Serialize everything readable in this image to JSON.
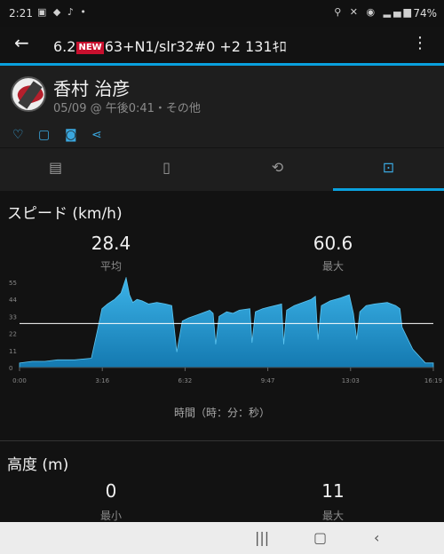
{
  "status_bar": {
    "time": "2:21",
    "battery": "74%"
  },
  "app_bar": {
    "title_pre": "6.2",
    "badge": "NEW",
    "title_post": "63+N1/slr32#0 +2 131ｷﾛ"
  },
  "activity": {
    "user_name": "香村 治彦",
    "meta": "05/09 @ 午後0:41・その他"
  },
  "speed": {
    "title": "スピード (km/h)",
    "avg_value": "28.4",
    "avg_label": "平均",
    "max_value": "60.6",
    "max_label": "最大",
    "x_axis_title": "時間（時：分：秒）"
  },
  "altitude": {
    "title": "高度 (m)",
    "min_value": "0",
    "min_label": "最小",
    "max_value": "11",
    "max_label": "最大"
  },
  "icons": {
    "back": "arrow-left-icon",
    "more": "more-vert-icon",
    "like": "heart-icon",
    "comment": "comment-icon",
    "photo": "camera-icon",
    "share": "share-icon",
    "tab_overview": "map-image-icon",
    "tab_details": "document-icon",
    "tab_laps": "laps-icon",
    "tab_charts": "chart-icon"
  },
  "colors": {
    "accent": "#0aa1de",
    "fill_top": "#3cb3e8",
    "fill_bottom": "#1479b0",
    "background": "#121212"
  },
  "chart_data": {
    "type": "area",
    "title": "スピード (km/h)",
    "xlabel": "時間（時：分：秒）",
    "ylabel": "",
    "x_tick_labels": [
      "0:00",
      "3:16",
      "6:32",
      "9:47",
      "13:03",
      "16:19"
    ],
    "y_tick_labels": [
      "0",
      "11",
      "22",
      "33",
      "44",
      "55"
    ],
    "ylim": [
      0,
      55
    ],
    "xlim_seconds": [
      0,
      979
    ],
    "average_line": 28.4,
    "max": 60.6,
    "series": [
      {
        "x": [
          0,
          30,
          60,
          90,
          130,
          170,
          185,
          195,
          208,
          225,
          240,
          252,
          260,
          268,
          278,
          290,
          305,
          325,
          345,
          360,
          365,
          372,
          385,
          400,
          420,
          440,
          450,
          458,
          464,
          472,
          490,
          505,
          520,
          545,
          550,
          558,
          575,
          590,
          605,
          620,
          625,
          632,
          650,
          670,
          690,
          700,
          706,
          714,
          735,
          760,
          780,
          790,
          798,
          805,
          820,
          840,
          870,
          890,
          900,
          905,
          930,
          960,
          979
        ],
        "y": [
          3,
          4,
          4,
          5,
          5,
          6,
          25,
          38,
          41,
          44,
          48,
          58,
          47,
          42,
          44,
          43,
          41,
          42,
          41,
          40,
          28,
          10,
          30,
          32,
          34,
          36,
          37,
          35,
          15,
          33,
          36,
          35,
          37,
          38,
          16,
          36,
          38,
          39,
          40,
          41,
          15,
          37,
          40,
          42,
          44,
          46,
          18,
          40,
          43,
          45,
          47,
          35,
          18,
          36,
          40,
          41,
          42,
          40,
          38,
          26,
          12,
          3,
          3
        ]
      }
    ]
  }
}
